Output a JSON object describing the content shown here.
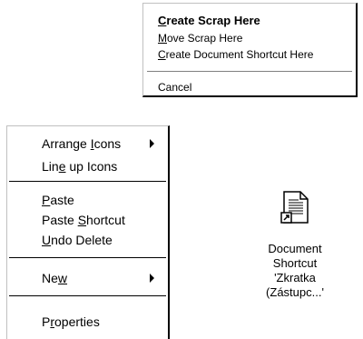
{
  "scrap_menu": {
    "items": [
      {
        "pre": "",
        "u": "C",
        "post": "reate Scrap Here",
        "bold": true
      },
      {
        "pre": "",
        "u": "M",
        "post": "ove Scrap Here",
        "bold": false
      },
      {
        "pre": "",
        "u": "C",
        "post": "reate Document Shortcut Here",
        "bold": false
      },
      {
        "pre": "",
        "u": "",
        "post": "Cancel",
        "bold": false
      }
    ]
  },
  "desktop_menu": {
    "items": [
      {
        "pre": "Arrange ",
        "u": "I",
        "post": "cons",
        "submenu": true
      },
      {
        "pre": "Lin",
        "u": "e",
        "post": " up Icons",
        "submenu": false
      },
      {
        "pre": "",
        "u": "P",
        "post": "aste",
        "submenu": false
      },
      {
        "pre": "Paste ",
        "u": "S",
        "post": "hortcut",
        "submenu": false
      },
      {
        "pre": "",
        "u": "U",
        "post": "ndo Delete",
        "submenu": false
      },
      {
        "pre": "Ne",
        "u": "w",
        "post": "",
        "submenu": true
      },
      {
        "pre": "P",
        "u": "r",
        "post": "operties",
        "submenu": false
      }
    ]
  },
  "shortcut": {
    "icon": "document-shortcut-icon",
    "caption_lines": [
      "Document",
      "Shortcut",
      "'Zkratka",
      "(Zástupc...'"
    ]
  }
}
